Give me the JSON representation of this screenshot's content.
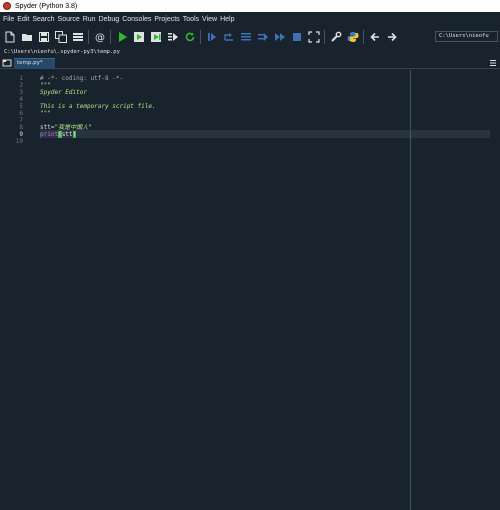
{
  "window": {
    "title": "Spyder (Python 3.8)"
  },
  "menubar": [
    "File",
    "Edit",
    "Search",
    "Source",
    "Run",
    "Debug",
    "Consoles",
    "Projects",
    "Tools",
    "View",
    "Help"
  ],
  "toolbar": {
    "path_value": "C:\\Users\\nieofu",
    "icons": [
      "new-file-icon",
      "open-folder-icon",
      "save-icon",
      "save-all-icon",
      "list-icon",
      "at-icon",
      "run-icon",
      "run-cell-icon",
      "run-cell-advance-icon",
      "run-selection-icon",
      "rerun-icon",
      "debug-icon",
      "step-icon",
      "step-into-icon",
      "step-return-icon",
      "continue-icon",
      "stop-icon",
      "maximize-icon",
      "wrench-icon",
      "python-icon",
      "back-arrow-icon",
      "forward-arrow-icon"
    ]
  },
  "filepath": "C:\\Users\\nieofu\\.spyder-py3\\temp.py",
  "tabs": [
    {
      "label": "temp.py*"
    }
  ],
  "editor": {
    "active_line": 9,
    "lines": [
      {
        "num": "1",
        "text": "# -*- coding: utf-8 -*-",
        "style": "comment"
      },
      {
        "num": "2",
        "text": "\"\"\"",
        "style": "string"
      },
      {
        "num": "3",
        "text": "Spyder Editor",
        "style": "string"
      },
      {
        "num": "4",
        "text": "",
        "style": "plain"
      },
      {
        "num": "5",
        "text": "This is a temporary script file.",
        "style": "string"
      },
      {
        "num": "6",
        "text": "\"\"\"",
        "style": "string"
      },
      {
        "num": "7",
        "text": "",
        "style": "plain"
      },
      {
        "num": "8",
        "text": "stt=\"我是中国人\"",
        "style": "mixed"
      },
      {
        "num": "9",
        "text": "print(stt)",
        "style": "call"
      },
      {
        "num": "10",
        "text": "",
        "style": "plain"
      }
    ],
    "line8": {
      "var": "stt",
      "op": "=",
      "str": "\"我是中国人\""
    },
    "line9": {
      "fn": "print",
      "open": "(",
      "arg": "stt",
      "close": ")"
    }
  },
  "colors": {
    "background": "#19232d",
    "comment": "#a9a9a9",
    "string": "#b0e686",
    "builtin": "#c670e0",
    "bracket_match": "#4caf50"
  }
}
